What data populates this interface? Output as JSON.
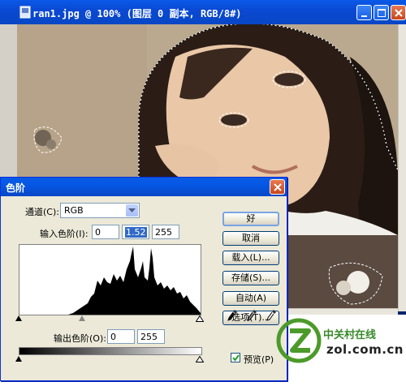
{
  "document_window": {
    "title": "ran1.jpg @ 100% (图层 0 副本, RGB/8#)"
  },
  "levels_dialog": {
    "title": "色阶",
    "channel_label": "通道(C):",
    "channel_value": "RGB",
    "input_levels_label": "输入色阶(I):",
    "input_black": "0",
    "input_gamma": "1.52",
    "input_white": "255",
    "output_levels_label": "输出色阶(O):",
    "output_black": "0",
    "output_white": "255",
    "buttons": {
      "ok": "好",
      "cancel": "取消",
      "load": "载入(L)...",
      "save": "存储(S)...",
      "auto": "自动(A)",
      "options": "选项(T)..."
    },
    "preview_label": "预览(P)",
    "preview_checked": true
  },
  "watermark": {
    "line1": "中关村在线",
    "line2": "zol.com.cn"
  },
  "colors": {
    "titlebar": "#0a49d4",
    "dialog_bg": "#ece9d8",
    "watermark_green": "#3a8a2a"
  }
}
